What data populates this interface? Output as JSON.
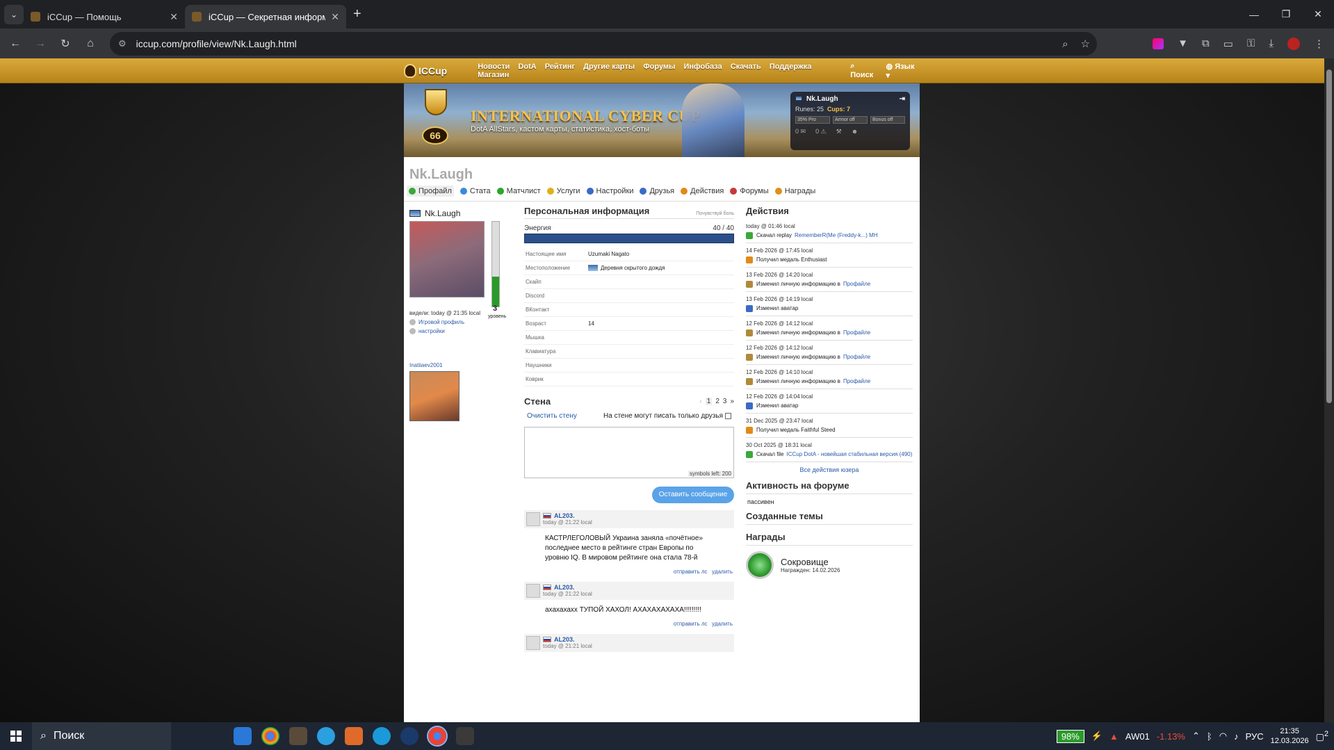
{
  "browser": {
    "tabs": [
      {
        "title": "iCCup — Помощь",
        "active": false
      },
      {
        "title": "iCCup — Секретная информа…",
        "active": true
      }
    ],
    "url": "iccup.com/profile/view/Nk.Laugh.html"
  },
  "site": {
    "logo": "ICCup",
    "nav": [
      "Новости",
      "DotA",
      "Рейтинг",
      "Другие карты",
      "Форумы",
      "Инфобаза",
      "Скачать",
      "Поддержка",
      "Магазин"
    ],
    "search_label": "Поиск",
    "lang_label": "Язык",
    "banner": {
      "title": "INTERNATIONAL CYBER CUP",
      "subtitle": "DotA AllStars, кастом карты, статистика, хост-боты",
      "level": "66"
    },
    "userbox": {
      "name": "Nk.Laugh",
      "runes_label": "Runes: 25",
      "cups_label": "Cups: 7",
      "pro": "35% Pro",
      "armor": "Armor off",
      "bonus": "Bonus off",
      "msgs": "0",
      "warns": "0"
    }
  },
  "profile": {
    "title": "Nk.Laugh",
    "tabs": [
      "Профайл",
      "Стата",
      "Матчлист",
      "Услуги",
      "Настройки",
      "Друзья",
      "Действия",
      "Форумы",
      "Награды"
    ],
    "name": "Nk.Laugh",
    "seen": "видели: today @ 21:35 local",
    "level_num": "3",
    "level_label": "уровень",
    "game_profile": "Игровой профиль",
    "settings": "настройки",
    "friend_name": "Inatiiaev2001"
  },
  "personal": {
    "heading": "Персональная информация",
    "note": "Почувствуй боль",
    "energy_label": "Энергия",
    "energy_value": "40 / 40",
    "energy_fraction": 1.0,
    "rows": [
      {
        "k": "Настоящее имя",
        "v": "Uzumaki Nagato"
      },
      {
        "k": "Местоположение",
        "v": "Деревня скрытого дождя"
      },
      {
        "k": "Скайп",
        "v": ""
      },
      {
        "k": "Discord",
        "v": ""
      },
      {
        "k": "ВКонтакт",
        "v": ""
      },
      {
        "k": "Возраст",
        "v": "14"
      },
      {
        "k": "Мышка",
        "v": ""
      },
      {
        "k": "Клавиатура",
        "v": ""
      },
      {
        "k": "Наушники",
        "v": ""
      },
      {
        "k": "Коврик",
        "v": ""
      }
    ]
  },
  "wall": {
    "heading": "Стена",
    "pages": [
      "1",
      "2",
      "3"
    ],
    "clear_label": "Очистить стену",
    "friends_only_label": "На стене могут писать только друзья",
    "symbols_left": "symbols left: 200",
    "post_button": "Оставить сообщение",
    "messages": [
      {
        "author": "AL203.",
        "time": "today @ 21:22 local",
        "text": "КАСТРЛЕГОЛОВЫЙ Украина заняла «почётное» последнее место в рейтинге стран Европы по уровню IQ. В мировом рейтинге она стала 78-й",
        "send_pm": "отправить лс",
        "delete": "удалить"
      },
      {
        "author": "AL203.",
        "time": "today @ 21:22 local",
        "text": "ахахахаxx ТУПОЙ ХАХОЛ! АХАХАХАХАХА!!!!!!!!!",
        "send_pm": "отправить лс",
        "delete": "удалить"
      },
      {
        "author": "AL203.",
        "time": "today @ 21:21 local",
        "text": "",
        "send_pm": "",
        "delete": ""
      }
    ]
  },
  "actions": {
    "heading": "Действия",
    "items": [
      {
        "date": "today @ 01:46 local",
        "text": "Скачал replay",
        "link": "RememberR(Me (Freddy-k...) MH",
        "icon_color": "#3aa83a"
      },
      {
        "date": "14 Feb 2026 @ 17:45 local",
        "text": "Получил медаль Enthusiast",
        "link": "",
        "icon_color": "#e08a1a"
      },
      {
        "date": "13 Feb 2026 @ 14:20 local",
        "text": "Изменил личную информацию в",
        "link": "Профайле",
        "icon_color": "#b08a3a"
      },
      {
        "date": "13 Feb 2026 @ 14:19 local",
        "text": "Изменил аватар",
        "link": "",
        "icon_color": "#3a6ac8"
      },
      {
        "date": "12 Feb 2026 @ 14:12 local",
        "text": "Изменил личную информацию в",
        "link": "Профайле",
        "icon_color": "#b08a3a"
      },
      {
        "date": "12 Feb 2026 @ 14:12 local",
        "text": "Изменил личную информацию в",
        "link": "Профайле",
        "icon_color": "#b08a3a"
      },
      {
        "date": "12 Feb 2026 @ 14:10 local",
        "text": "Изменил личную информацию в",
        "link": "Профайле",
        "icon_color": "#b08a3a"
      },
      {
        "date": "12 Feb 2026 @ 14:04 local",
        "text": "Изменил аватар",
        "link": "",
        "icon_color": "#3a6ac8"
      },
      {
        "date": "31 Dec 2025 @ 23:47 local",
        "text": "Получил медаль Faithful Steed",
        "link": "",
        "icon_color": "#e08a1a"
      },
      {
        "date": "30 Oct 2025 @ 18:31 local",
        "text": "Скачал file",
        "link": "ICCup DotA - новейшая стабильная версия (490)",
        "icon_color": "#3aa83a"
      }
    ],
    "all_link": "Все действия юзера",
    "forum_heading": "Активность на форуме",
    "forum_value": "пассивен",
    "topics_heading": "Созданные темы",
    "awards_heading": "Награды",
    "award_name": "Сокровище",
    "award_date": "Награжден: 14.02.2026"
  },
  "taskbar": {
    "search": "Поиск",
    "battery": "98%",
    "stock_name": "AW01",
    "stock_change": "-1.13%",
    "lang": "РУС",
    "time": "21:35",
    "date": "12.03.2026",
    "notif": "2"
  }
}
